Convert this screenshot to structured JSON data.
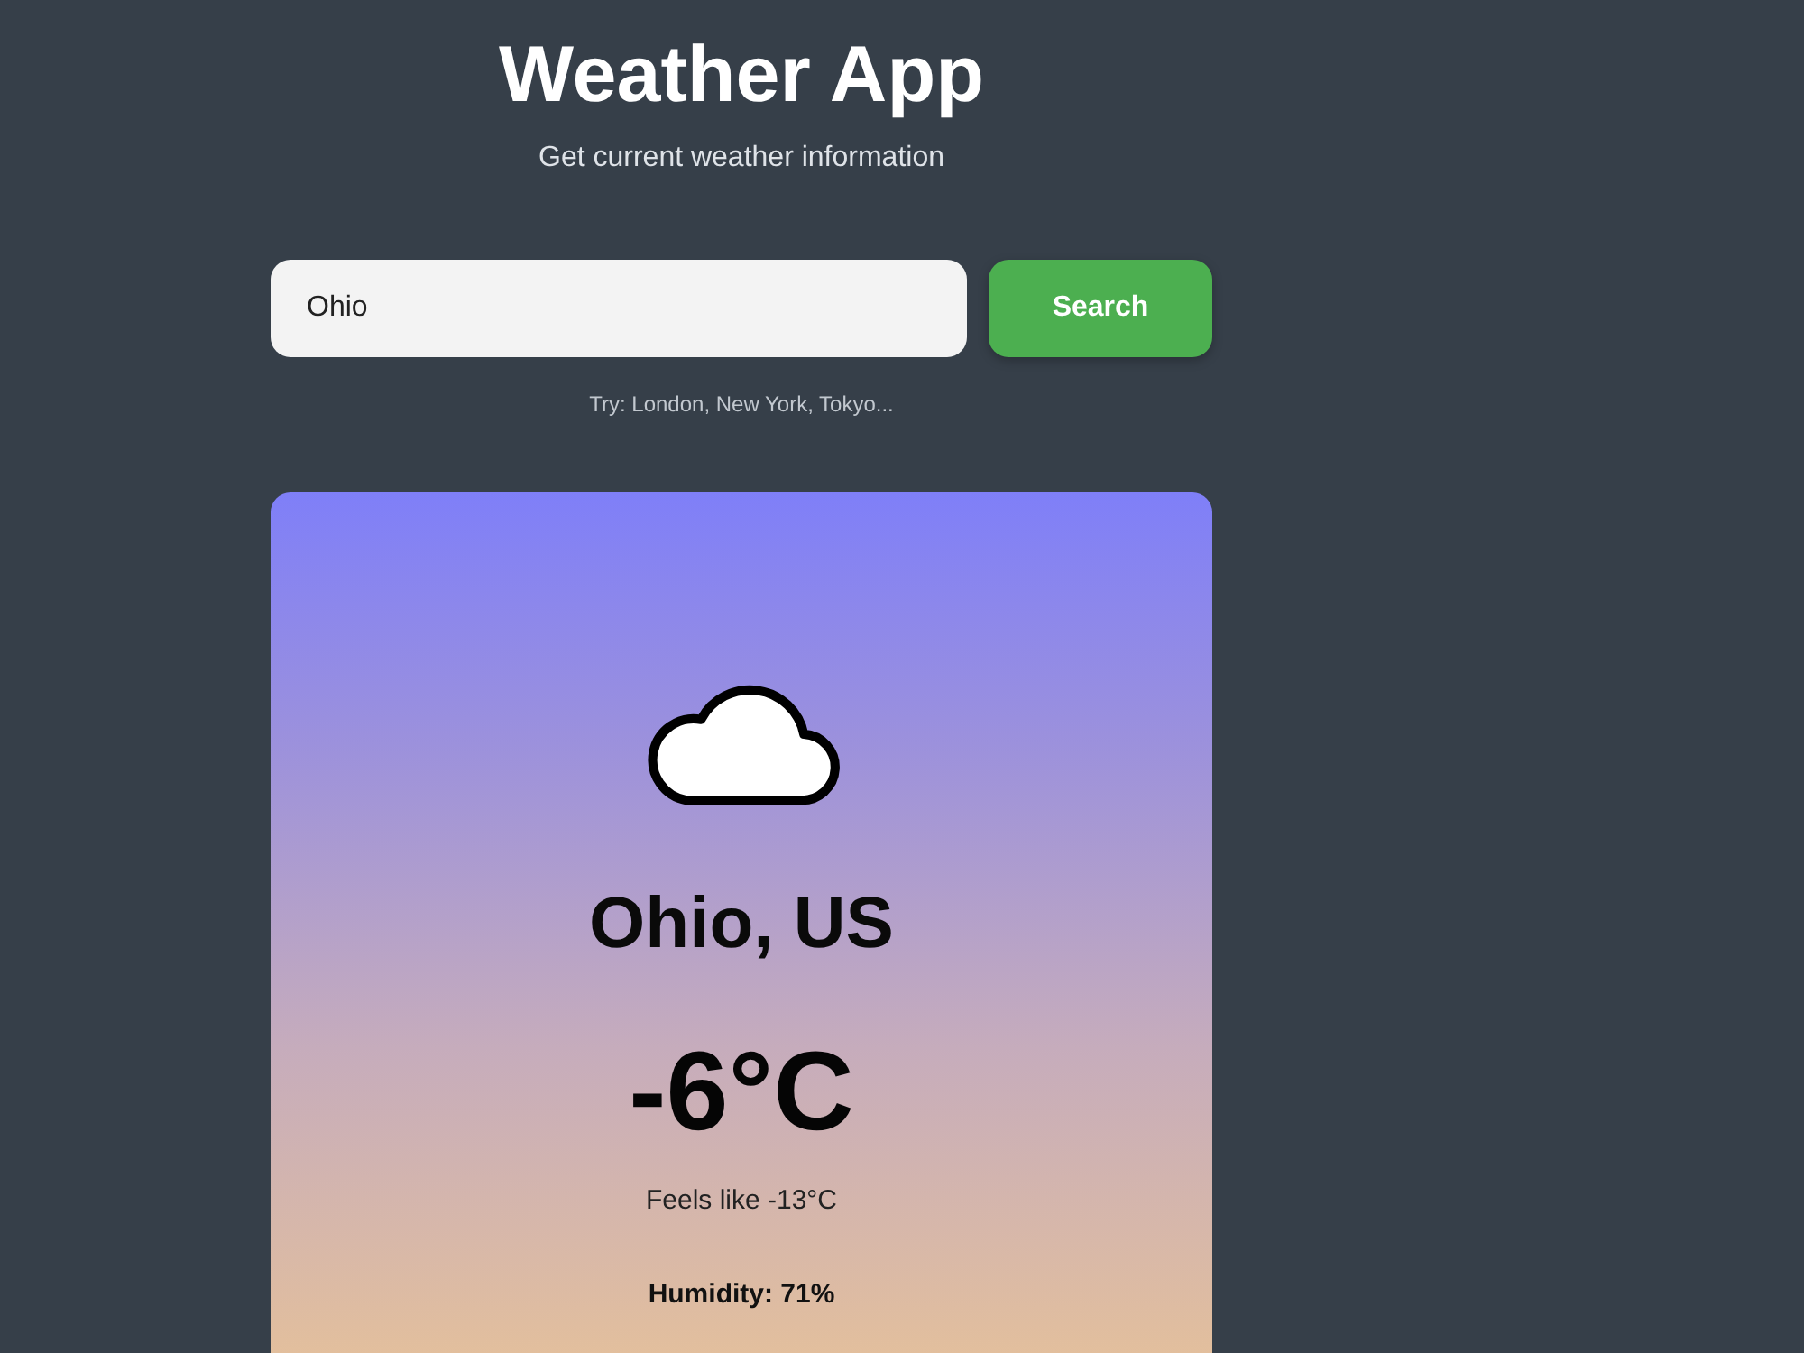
{
  "header": {
    "title": "Weather App",
    "subtitle": "Get current weather information"
  },
  "search": {
    "value": "Ohio",
    "button": "Search",
    "hint": "Try: London, New York, Tokyo..."
  },
  "weather": {
    "location": "Ohio, US",
    "temperature": "-6°C",
    "feels_like": "Feels like -13°C",
    "details": [
      "Humidity: 71%"
    ]
  }
}
